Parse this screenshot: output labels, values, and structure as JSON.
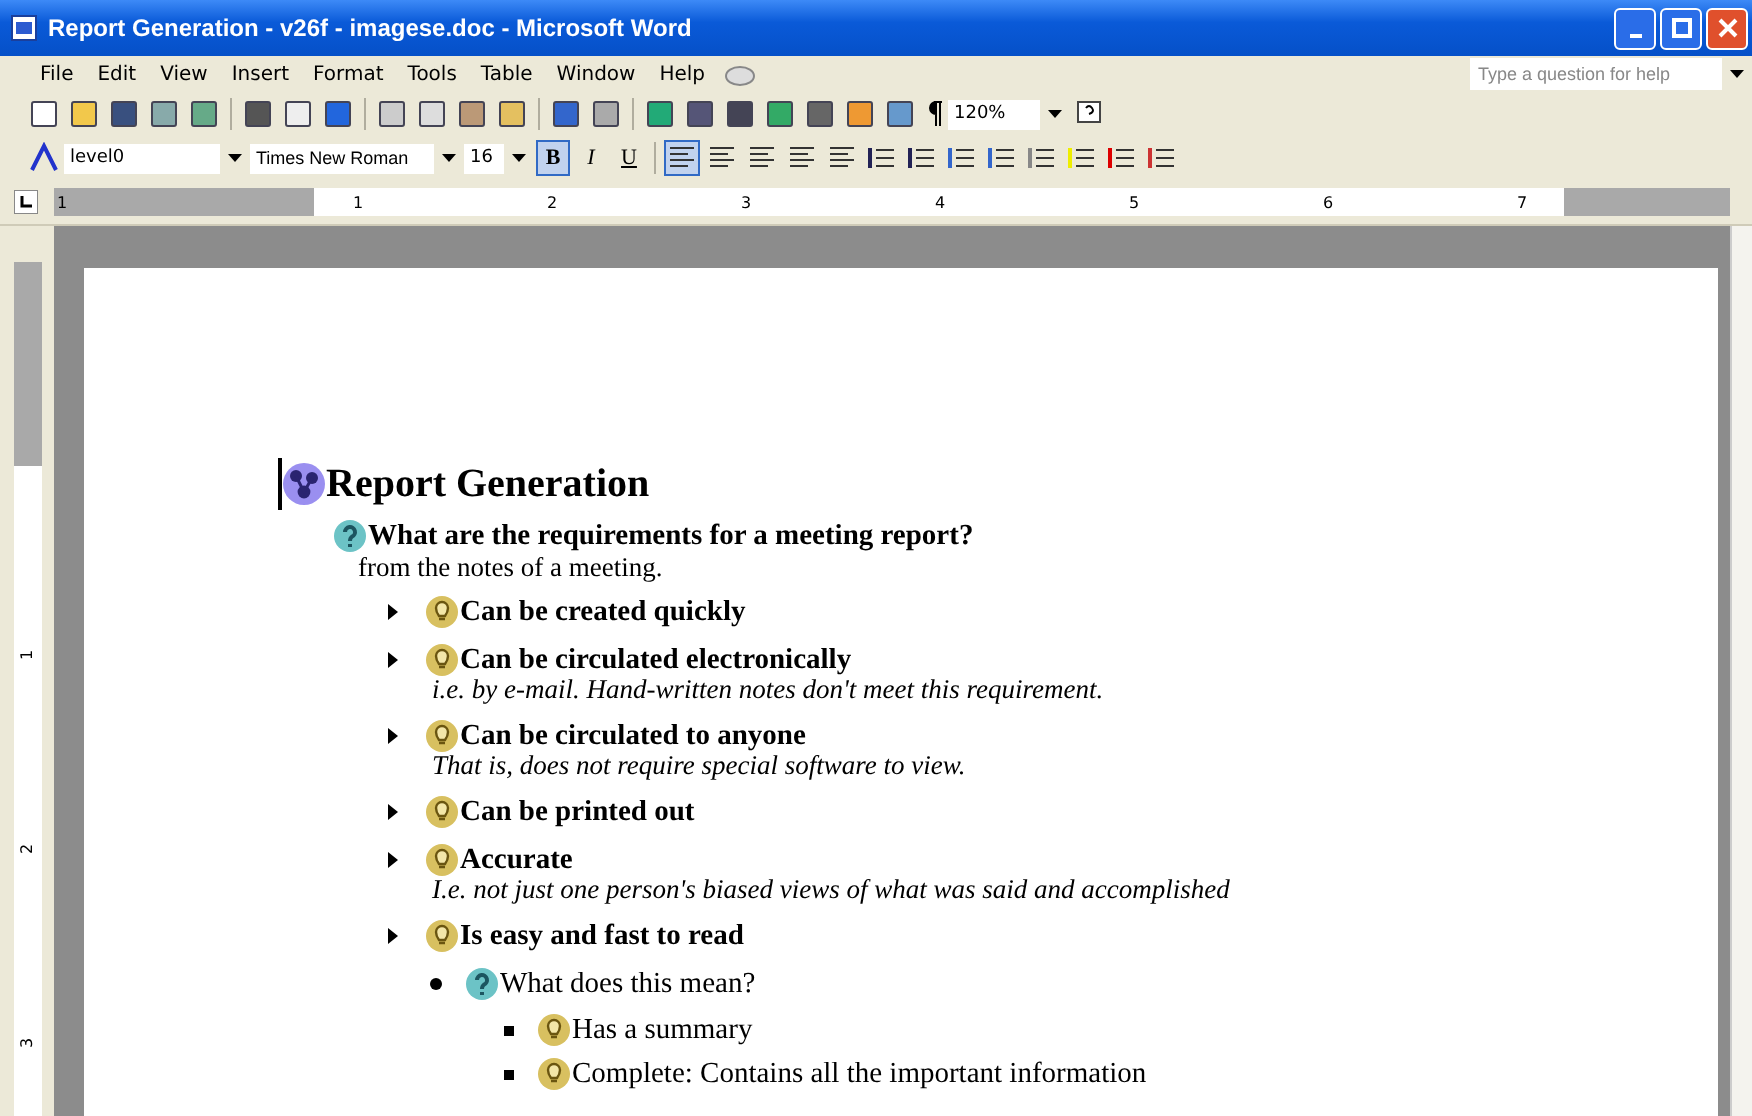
{
  "window": {
    "title": "Report Generation - v26f - imagese.doc - Microsoft Word"
  },
  "menu": [
    "File",
    "Edit",
    "View",
    "Insert",
    "Format",
    "Tools",
    "Table",
    "Window",
    "Help"
  ],
  "help_search": {
    "placeholder": "Type a question for help"
  },
  "standard_toolbar": {
    "zoom": "120%"
  },
  "formatting_toolbar": {
    "style": "level0",
    "font": "Times New Roman",
    "size": "16",
    "bold": "B",
    "italic": "I",
    "underline": "U"
  },
  "ruler": [
    "1",
    "1",
    "2",
    "3",
    "4",
    "5",
    "6",
    "7"
  ],
  "vertical_ruler": [
    "1",
    "2",
    "3"
  ],
  "document": {
    "title": "Report Generation",
    "children": [
      {
        "kind": "question",
        "text": "What are the requirements for a meeting report?",
        "note": "from the notes of a meeting.",
        "children": [
          {
            "kind": "idea",
            "text": "Can be created quickly"
          },
          {
            "kind": "idea",
            "text": "Can be circulated electronically",
            "note": "i.e. by e-mail. Hand-written notes don't meet this requirement."
          },
          {
            "kind": "idea",
            "text": "Can be circulated to anyone",
            "note": "That is, does not require special software to view."
          },
          {
            "kind": "idea",
            "text": "Can be printed out"
          },
          {
            "kind": "idea",
            "text": "Accurate",
            "note": "I.e. not just one person's biased views of what was said and accomplished"
          },
          {
            "kind": "idea",
            "text": "Is easy and fast to read",
            "children": [
              {
                "kind": "question",
                "text": "What does this mean?",
                "children": [
                  {
                    "kind": "idea",
                    "text": "Has a summary"
                  },
                  {
                    "kind": "idea",
                    "text": "Complete: Contains all the important information"
                  }
                ]
              }
            ]
          }
        ]
      }
    ]
  }
}
